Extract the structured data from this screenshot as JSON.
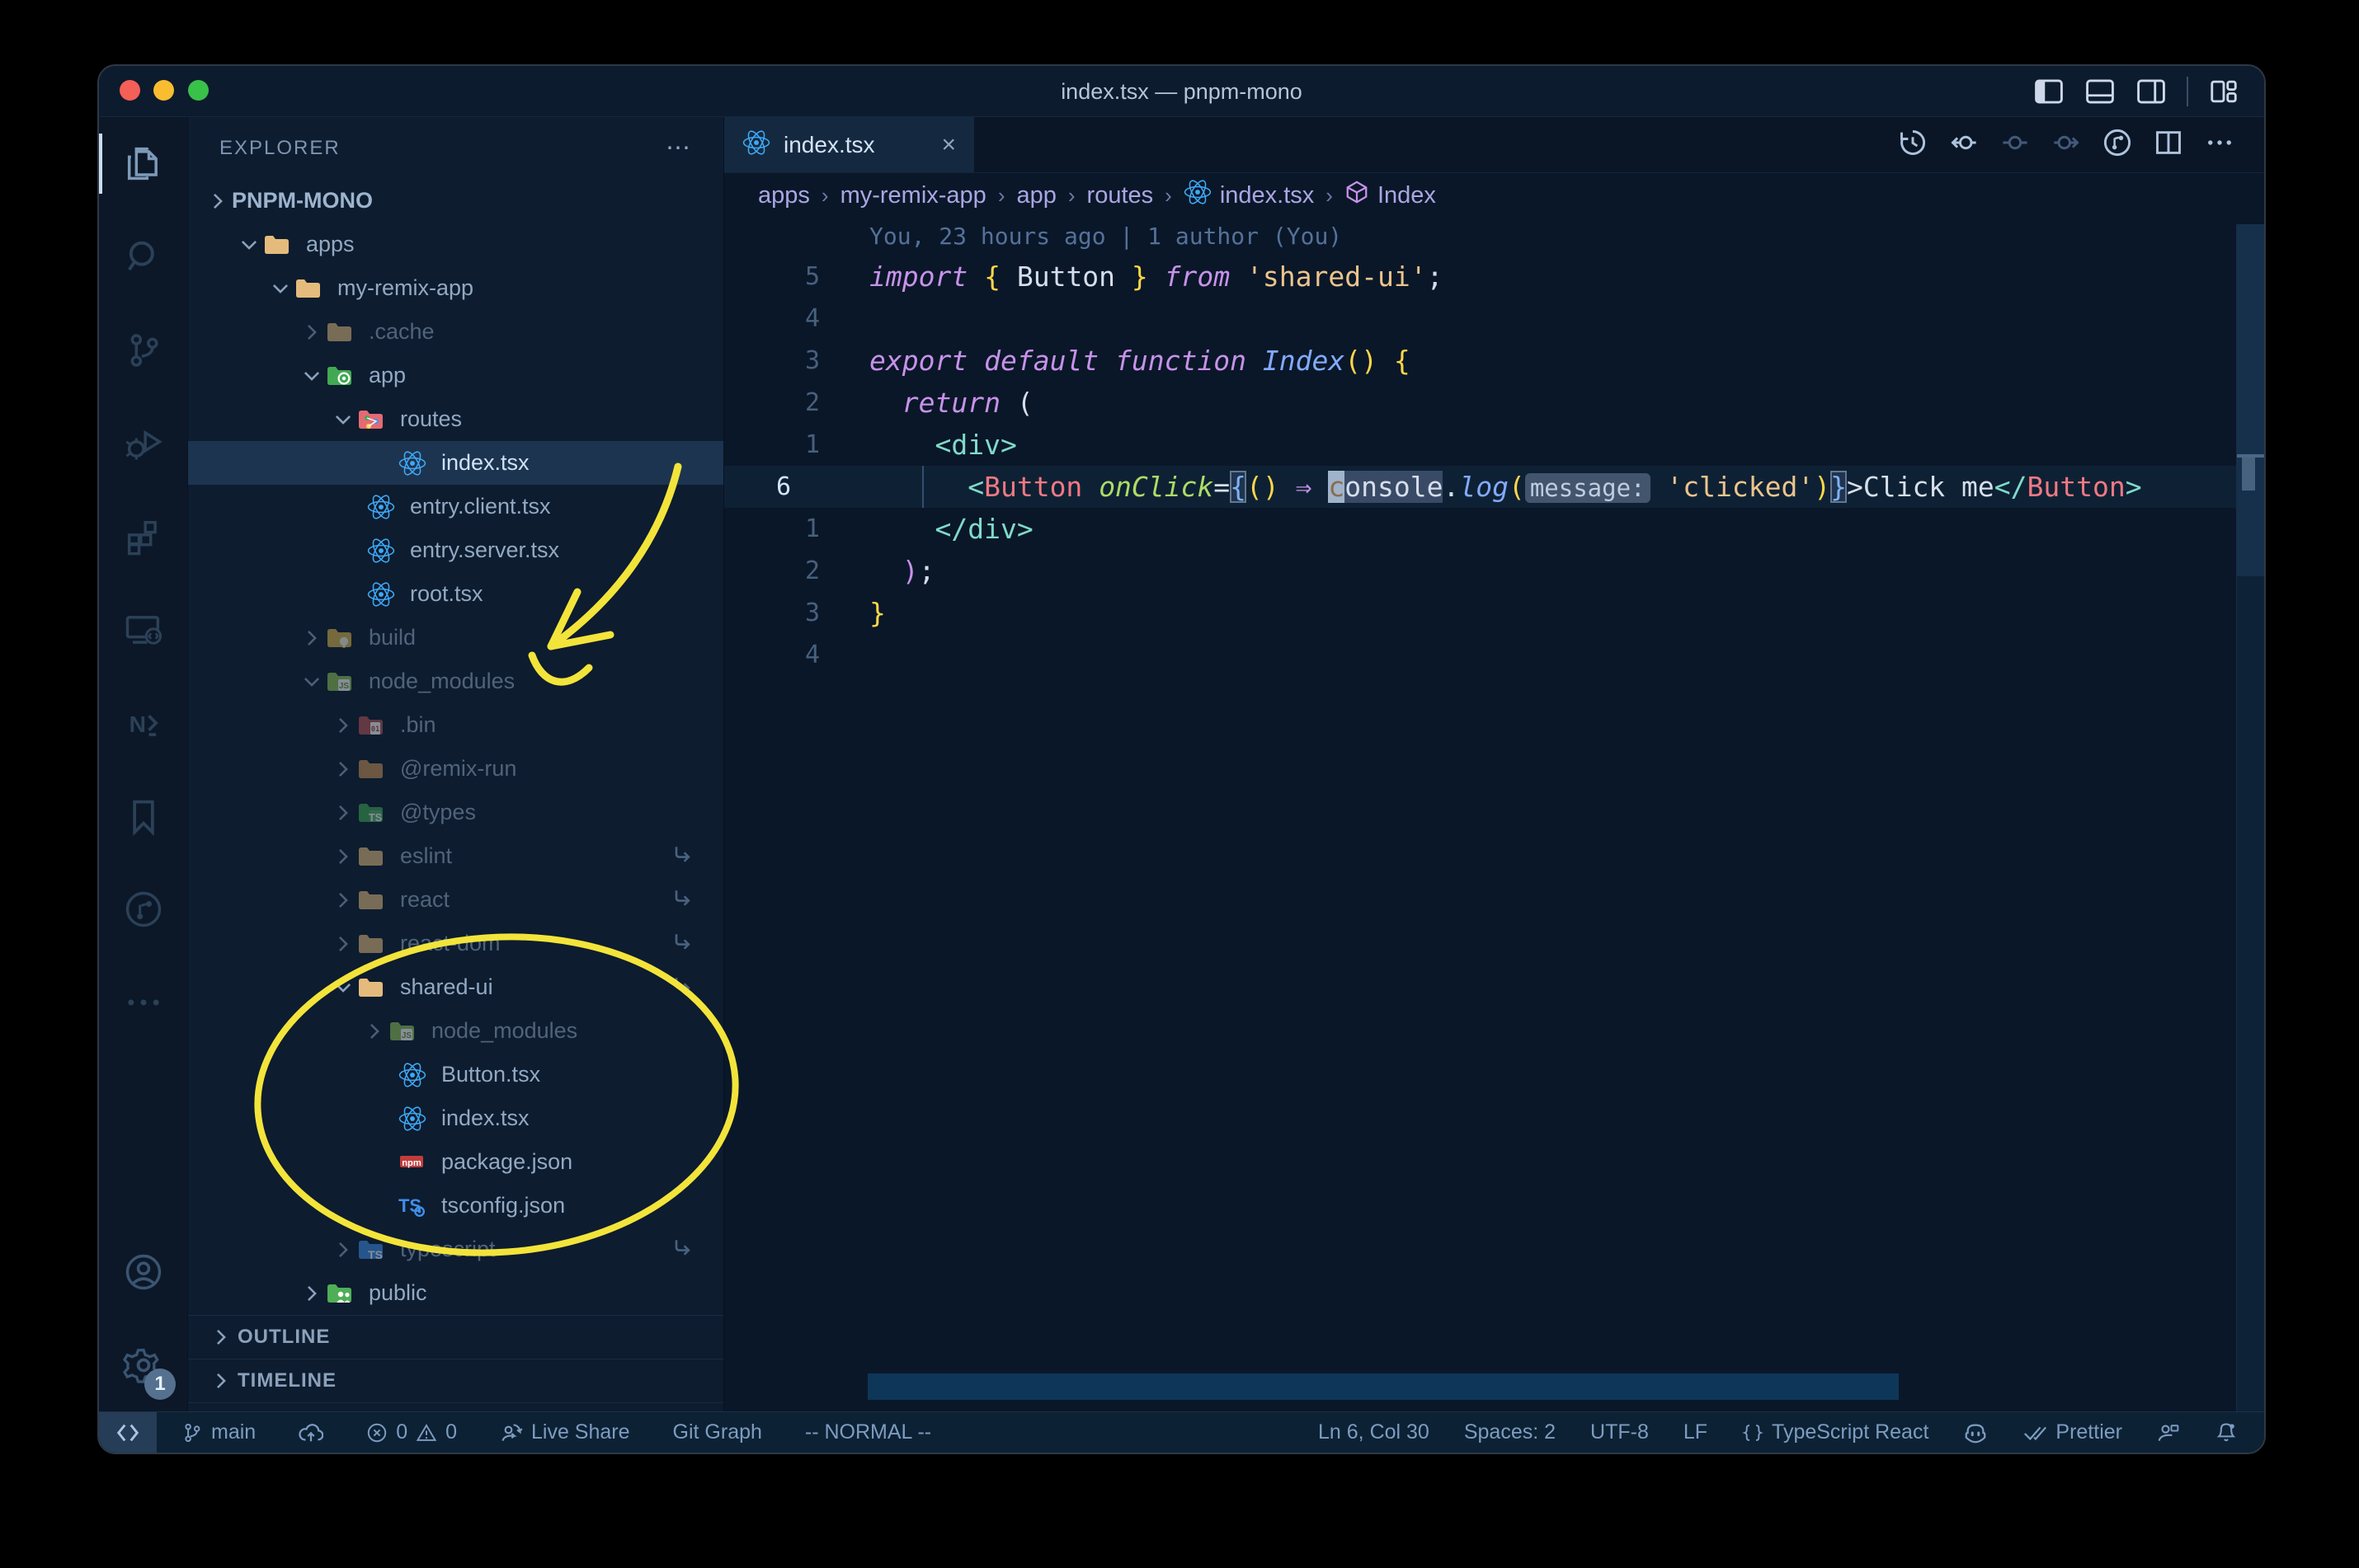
{
  "window": {
    "title": "index.tsx — pnpm-mono"
  },
  "colors": {
    "accent_yellow": "#f3e43b",
    "traffic_close": "#f45f57",
    "traffic_min": "#f9bd2f",
    "traffic_max": "#39c149",
    "react_icon": "#3fa9f5"
  },
  "title_controls": [
    {
      "icon": "layout-sidebar-left"
    },
    {
      "icon": "layout-panel"
    },
    {
      "icon": "layout-sidebar-right"
    },
    {
      "icon": "layout-customize"
    }
  ],
  "activity_bar": {
    "items": [
      {
        "icon": "explorer",
        "active": true
      },
      {
        "icon": "search"
      },
      {
        "icon": "source-control"
      },
      {
        "icon": "run-debug"
      },
      {
        "icon": "extensions"
      },
      {
        "icon": "remote-explorer"
      },
      {
        "icon": "nx-console"
      },
      {
        "icon": "bookmarks"
      },
      {
        "icon": "git-history"
      },
      {
        "icon": "more"
      }
    ],
    "bottom": [
      {
        "icon": "account"
      },
      {
        "icon": "settings",
        "badge": "1"
      }
    ]
  },
  "sidebar": {
    "header": "EXPLORER",
    "more_label": "⋯",
    "root": "PNPM-MONO",
    "rows": [
      {
        "label": "apps",
        "level": 1,
        "chevron": "down",
        "icon": "folder-tan"
      },
      {
        "label": "my-remix-app",
        "level": 2,
        "chevron": "down",
        "icon": "folder-tan"
      },
      {
        "label": ".cache",
        "level": 3,
        "chevron": "right",
        "icon": "folder-tan",
        "dim": true
      },
      {
        "label": "app",
        "level": 3,
        "chevron": "down",
        "icon": "folder-app"
      },
      {
        "label": "routes",
        "level": 4,
        "chevron": "down",
        "icon": "folder-routes"
      },
      {
        "label": "index.tsx",
        "level": 5,
        "chevron": "none",
        "icon": "react",
        "file": true,
        "selected": true
      },
      {
        "label": "entry.client.tsx",
        "level": 4,
        "chevron": "none",
        "icon": "react",
        "file": true
      },
      {
        "label": "entry.server.tsx",
        "level": 4,
        "chevron": "none",
        "icon": "react",
        "file": true
      },
      {
        "label": "root.tsx",
        "level": 4,
        "chevron": "none",
        "icon": "react",
        "file": true
      },
      {
        "label": "build",
        "level": 3,
        "chevron": "right",
        "icon": "folder-build",
        "dim": true
      },
      {
        "label": "node_modules",
        "level": 3,
        "chevron": "down",
        "icon": "folder-node",
        "dim": true
      },
      {
        "label": ".bin",
        "level": 4,
        "chevron": "right",
        "icon": "folder-bin",
        "dim": true
      },
      {
        "label": "@remix-run",
        "level": 4,
        "chevron": "right",
        "icon": "folder-dark",
        "dim": true
      },
      {
        "label": "@types",
        "level": 4,
        "chevron": "right",
        "icon": "folder-types",
        "dim": true
      },
      {
        "label": "eslint",
        "level": 4,
        "chevron": "right",
        "icon": "folder-tan",
        "dim": true,
        "symlink": true
      },
      {
        "label": "react",
        "level": 4,
        "chevron": "right",
        "icon": "folder-tan",
        "dim": true,
        "symlink": true
      },
      {
        "label": "react-dom",
        "level": 4,
        "chevron": "right",
        "icon": "folder-tan",
        "dim": true,
        "symlink": true
      },
      {
        "label": "shared-ui",
        "level": 4,
        "chevron": "down",
        "icon": "folder-tan",
        "symlink": true
      },
      {
        "label": "node_modules",
        "level": 5,
        "chevron": "right",
        "icon": "folder-node",
        "dim": true
      },
      {
        "label": "Button.tsx",
        "level": 5,
        "chevron": "none",
        "icon": "react",
        "file": true
      },
      {
        "label": "index.tsx",
        "level": 5,
        "chevron": "none",
        "icon": "react",
        "file": true
      },
      {
        "label": "package.json",
        "level": 5,
        "chevron": "none",
        "icon": "npm",
        "file": true
      },
      {
        "label": "tsconfig.json",
        "level": 5,
        "chevron": "none",
        "icon": "tsconfig",
        "file": true
      },
      {
        "label": "typescript",
        "level": 4,
        "chevron": "right",
        "icon": "folder-ts",
        "dim": true,
        "symlink": true
      },
      {
        "label": "public",
        "level": 3,
        "chevron": "right",
        "icon": "folder-public"
      }
    ],
    "sections": [
      "OUTLINE",
      "TIMELINE"
    ]
  },
  "tab": {
    "label": "index.tsx",
    "icon": "react",
    "close": "×"
  },
  "editor_actions": [
    {
      "icon": "timeline-history",
      "bright": true
    },
    {
      "icon": "prev-change",
      "bright": true
    },
    {
      "icon": "current-change",
      "bright": false
    },
    {
      "icon": "next-change",
      "bright": false
    },
    {
      "icon": "file-history",
      "bright": true
    },
    {
      "icon": "split-editor",
      "bright": true
    },
    {
      "icon": "more-actions",
      "bright": true
    }
  ],
  "breadcrumbs": [
    {
      "label": "apps"
    },
    {
      "label": "my-remix-app"
    },
    {
      "label": "app"
    },
    {
      "label": "routes"
    },
    {
      "label": "index.tsx",
      "icon": "react"
    },
    {
      "label": "Index",
      "icon": "symbol-module"
    }
  ],
  "editor": {
    "blame": "You, 23 hours ago | 1 author (You)",
    "lines": [
      {
        "num": "5",
        "tokens": [
          [
            "kw",
            "import"
          ],
          [
            "plain",
            " "
          ],
          [
            "gold",
            "{"
          ],
          [
            "plain",
            " Button "
          ],
          [
            "gold",
            "}"
          ],
          [
            "plain",
            " "
          ],
          [
            "kw",
            "from"
          ],
          [
            "plain",
            " "
          ],
          [
            "str",
            "'shared-ui'"
          ],
          [
            "plain",
            ";"
          ]
        ]
      },
      {
        "num": "4",
        "tokens": []
      },
      {
        "num": "3",
        "tokens": [
          [
            "kw",
            "export"
          ],
          [
            "plain",
            " "
          ],
          [
            "kw",
            "default"
          ],
          [
            "plain",
            " "
          ],
          [
            "kw",
            "function"
          ],
          [
            "plain",
            " "
          ],
          [
            "fn",
            "Index"
          ],
          [
            "gold",
            "()"
          ],
          [
            "plain",
            " "
          ],
          [
            "gold",
            "{"
          ]
        ]
      },
      {
        "num": "2",
        "tokens": [
          [
            "plain",
            "  "
          ],
          [
            "kw",
            "return"
          ],
          [
            "plain",
            " ("
          ]
        ]
      },
      {
        "num": "1",
        "tokens": [
          [
            "plain",
            "    "
          ],
          [
            "tagp",
            "<div>"
          ]
        ]
      },
      {
        "num": "6",
        "current": true,
        "tokens": [
          [
            "plain",
            "      "
          ],
          [
            "tagp",
            "<"
          ],
          [
            "tag",
            "Button"
          ],
          [
            "plain",
            " "
          ],
          [
            "attr",
            "onClick"
          ],
          [
            "plain",
            "="
          ],
          [
            "match",
            "{"
          ],
          [
            "gold",
            "()"
          ],
          [
            "plain",
            " "
          ],
          [
            "kw",
            "⇒"
          ],
          [
            "plain",
            " "
          ],
          [
            "cur",
            "c"
          ],
          [
            "whl",
            "onsole"
          ],
          [
            "plain",
            "."
          ],
          [
            "prop",
            "log"
          ],
          [
            "gold",
            "("
          ],
          [
            "inlay",
            "message:"
          ],
          [
            "plain",
            " "
          ],
          [
            "str",
            "'clicked'"
          ],
          [
            "gold",
            ")"
          ],
          [
            "match",
            "}"
          ],
          [
            "plain",
            ">Click me"
          ],
          [
            "tagp",
            "</"
          ],
          [
            "tag",
            "Button"
          ],
          [
            "tagp",
            ">"
          ]
        ]
      },
      {
        "num": "1",
        "tokens": [
          [
            "plain",
            "    "
          ],
          [
            "tagp",
            "</div>"
          ]
        ]
      },
      {
        "num": "2",
        "tokens": [
          [
            "plain",
            "  "
          ],
          [
            "pink",
            ")"
          ],
          [
            "plain",
            ";"
          ]
        ]
      },
      {
        "num": "3",
        "tokens": [
          [
            "gold",
            "}"
          ]
        ]
      },
      {
        "num": "4",
        "tokens": []
      }
    ]
  },
  "status_bar": {
    "left": [
      {
        "icon": "branch",
        "label": "main"
      },
      {
        "icon": "cloud-upload",
        "label": ""
      },
      {
        "icon": "error",
        "label": "0",
        "icon2": "warning",
        "label2": "0"
      },
      {
        "icon": "live-share",
        "label": "Live Share"
      },
      {
        "label": "Git Graph"
      },
      {
        "label": "-- NORMAL --"
      }
    ],
    "right": [
      {
        "label": "Ln 6, Col 30"
      },
      {
        "label": "Spaces: 2"
      },
      {
        "label": "UTF-8"
      },
      {
        "label": "LF"
      },
      {
        "icon": "braces",
        "label": "TypeScript React"
      },
      {
        "icon": "copilot",
        "label": ""
      },
      {
        "icon": "double-check",
        "label": "Prettier"
      },
      {
        "icon": "person-feedback",
        "label": ""
      },
      {
        "icon": "bell",
        "label": ""
      }
    ]
  }
}
